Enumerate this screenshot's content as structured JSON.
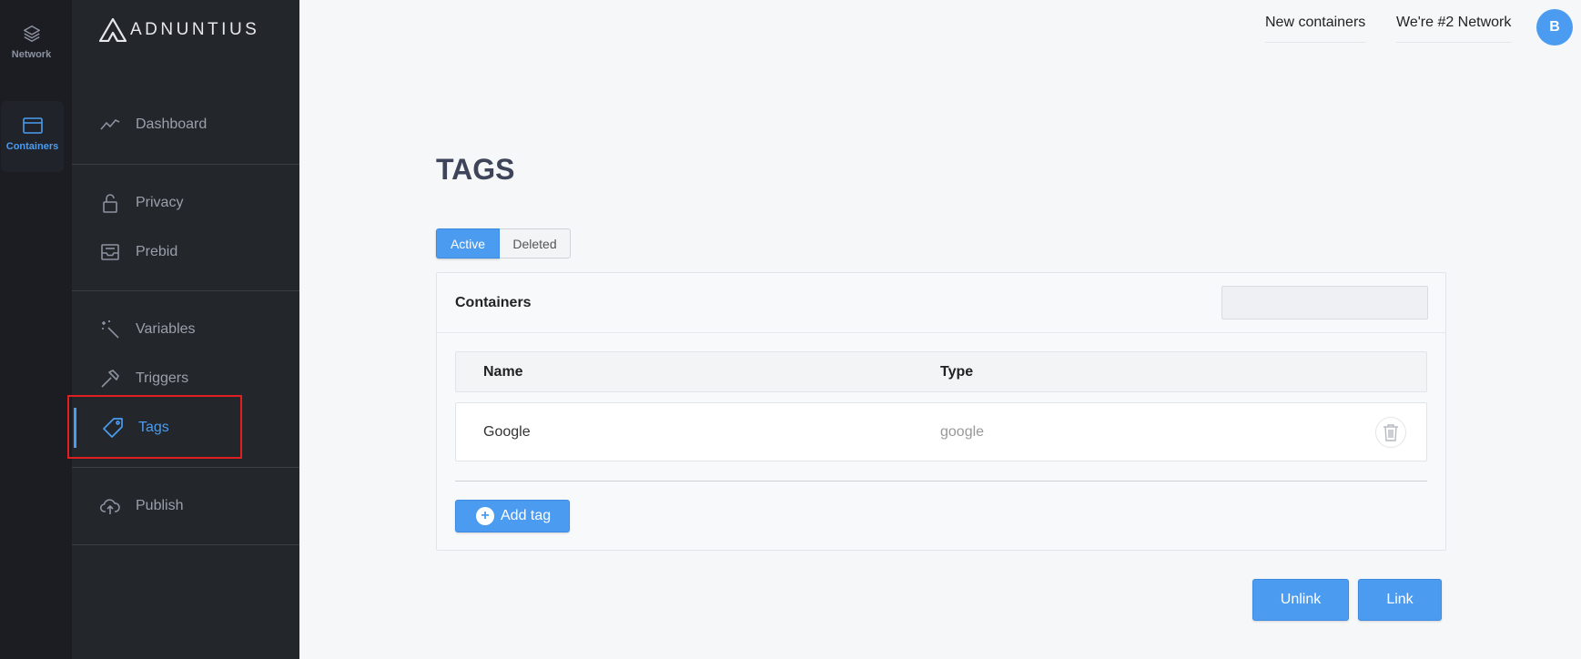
{
  "rail": {
    "network_label": "Network",
    "containers_label": "Containers"
  },
  "sidebar": {
    "logo_text": "ADNUNTIUS",
    "items": [
      {
        "label": "Dashboard",
        "icon": "chart-line-icon"
      },
      {
        "label": "Privacy",
        "icon": "lock-icon"
      },
      {
        "label": "Prebid",
        "icon": "inbox-icon"
      },
      {
        "label": "Variables",
        "icon": "magic-wand-icon"
      },
      {
        "label": "Triggers",
        "icon": "hammer-icon"
      },
      {
        "label": "Tags",
        "icon": "tag-icon",
        "active": true
      },
      {
        "label": "Publish",
        "icon": "cloud-upload-icon"
      }
    ]
  },
  "header": {
    "link_new_containers": "New containers",
    "link_network": "We're #2 Network",
    "avatar_initial": "B"
  },
  "main": {
    "title": "TAGS",
    "filters": {
      "active": "Active",
      "deleted": "Deleted"
    },
    "panel": {
      "title": "Containers",
      "search_value": "",
      "columns": {
        "name": "Name",
        "type": "Type"
      },
      "rows": [
        {
          "name": "Google",
          "type": "google"
        }
      ],
      "add_label": "Add tag"
    },
    "actions": {
      "unlink": "Unlink",
      "link": "Link"
    }
  },
  "colors": {
    "accent": "#4b9cf0",
    "sidebar_bg": "#23262b",
    "rail_bg": "#1b1d22",
    "highlight": "#e02020"
  }
}
